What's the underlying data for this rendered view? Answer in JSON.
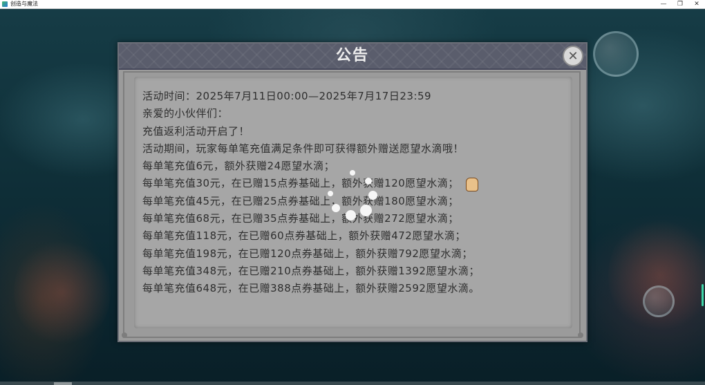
{
  "window": {
    "title": "创造与魔法",
    "controls": {
      "minimize": "—",
      "restore": "❐",
      "close": "✕"
    }
  },
  "dialog": {
    "title": "公告",
    "close_icon": "✕",
    "lines": [
      "活动时间：2025年7月11日00:00—2025年7月17日23:59",
      "亲爱的小伙伴们：",
      "充值返利活动开启了！",
      "活动期间，玩家每单笔充值满足条件即可获得额外赠送愿望水滴哦！",
      "每单笔充值6元，额外获赠24愿望水滴；",
      "每单笔充值30元，在已赠15点券基础上，额外获赠120愿望水滴；",
      "每单笔充值45元，在已赠25点券基础上，额外获赠180愿望水滴；",
      "每单笔充值68元，在已赠35点券基础上，额外获赠272愿望水滴；",
      "每单笔充值118元，在已赠60点券基础上，额外获赠472愿望水滴；",
      "每单笔充值198元，在已赠120点券基础上，额外获赠792愿望水滴；",
      "每单笔充值348元，在已赠210点券基础上，额外获赠1392愿望水滴；",
      "每单笔充值648元，在已赠388点券基础上，额外获赠2592愿望水滴。"
    ]
  },
  "icons": {
    "app": "app-icon",
    "close": "close-icon",
    "loading": "loading-spinner-icon",
    "cursor": "hand-cursor-icon"
  },
  "colors": {
    "dialog_header": "#5a5d6c",
    "dialog_body": "#9b9b9b",
    "text": "#2e2e2e",
    "title_text": "#eeeeee"
  }
}
